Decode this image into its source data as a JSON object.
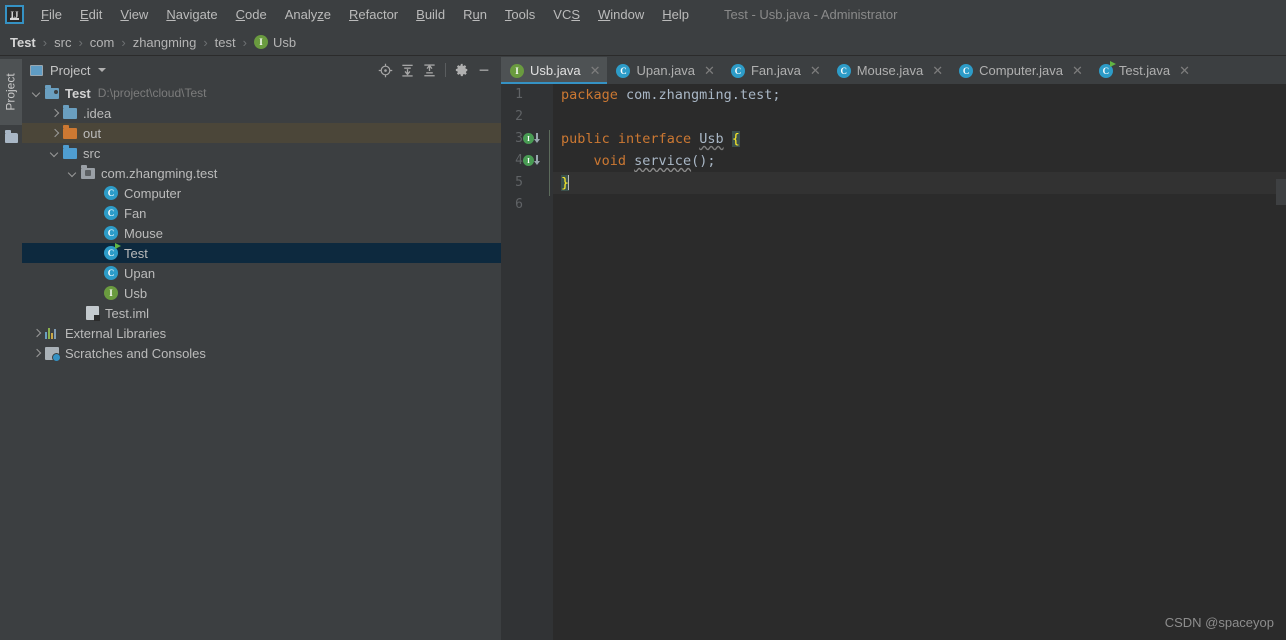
{
  "window": {
    "title": "Test - Usb.java - Administrator",
    "logo_text": "IJ"
  },
  "menubar": {
    "items": [
      {
        "label": "File",
        "mnemonic": "F"
      },
      {
        "label": "Edit",
        "mnemonic": "E"
      },
      {
        "label": "View",
        "mnemonic": "V"
      },
      {
        "label": "Navigate",
        "mnemonic": "N"
      },
      {
        "label": "Code",
        "mnemonic": "C"
      },
      {
        "label": "Analyze",
        "mnemonic": "z"
      },
      {
        "label": "Refactor",
        "mnemonic": "R"
      },
      {
        "label": "Build",
        "mnemonic": "B"
      },
      {
        "label": "Run",
        "mnemonic": "u"
      },
      {
        "label": "Tools",
        "mnemonic": "T"
      },
      {
        "label": "VCS",
        "mnemonic": "S"
      },
      {
        "label": "Window",
        "mnemonic": "W"
      },
      {
        "label": "Help",
        "mnemonic": "H"
      }
    ]
  },
  "navbar": {
    "crumbs": [
      {
        "label": "Test",
        "icon": "none"
      },
      {
        "label": "src",
        "icon": "none"
      },
      {
        "label": "com",
        "icon": "none"
      },
      {
        "label": "zhangming",
        "icon": "none"
      },
      {
        "label": "test",
        "icon": "none"
      },
      {
        "label": "Usb",
        "icon": "interface-icon"
      }
    ],
    "separator": "›"
  },
  "toolstrip": {
    "project_label": "Project"
  },
  "project_panel": {
    "title": "Project",
    "tools": [
      {
        "name": "locate-icon",
        "tooltip": "Select Opened File"
      },
      {
        "name": "expand-all-icon",
        "tooltip": "Expand All"
      },
      {
        "name": "collapse-all-icon",
        "tooltip": "Collapse All"
      },
      {
        "name": "gear-icon",
        "tooltip": "Settings"
      },
      {
        "name": "minimize-icon",
        "tooltip": "Hide"
      }
    ],
    "tree": [
      {
        "label": "Test",
        "path": "D:\\project\\cloud\\Test",
        "icon": "module-folder",
        "arrow": "down",
        "indent": 0,
        "state": "normal",
        "bold": true
      },
      {
        "label": ".idea",
        "path": "",
        "icon": "folder-blue",
        "arrow": "right",
        "indent": 1,
        "state": "normal",
        "bold": false
      },
      {
        "label": "out",
        "path": "",
        "icon": "folder-orange",
        "arrow": "right",
        "indent": 1,
        "state": "hovered",
        "bold": false
      },
      {
        "label": "src",
        "path": "",
        "icon": "folder-src",
        "arrow": "down",
        "indent": 1,
        "state": "normal",
        "bold": false
      },
      {
        "label": "com.zhangming.test",
        "path": "",
        "icon": "package-icon",
        "arrow": "down",
        "indent": 2,
        "state": "normal",
        "bold": false
      },
      {
        "label": "Computer",
        "path": "",
        "icon": "class-icon",
        "arrow": "none",
        "indent": 3,
        "state": "normal",
        "bold": false
      },
      {
        "label": "Fan",
        "path": "",
        "icon": "class-icon",
        "arrow": "none",
        "indent": 3,
        "state": "normal",
        "bold": false
      },
      {
        "label": "Mouse",
        "path": "",
        "icon": "class-icon",
        "arrow": "none",
        "indent": 3,
        "state": "normal",
        "bold": false
      },
      {
        "label": "Test",
        "path": "",
        "icon": "runnable-class-icon",
        "arrow": "none",
        "indent": 3,
        "state": "selected",
        "bold": false
      },
      {
        "label": "Upan",
        "path": "",
        "icon": "class-icon",
        "arrow": "none",
        "indent": 3,
        "state": "normal",
        "bold": false
      },
      {
        "label": "Usb",
        "path": "",
        "icon": "interface-icon",
        "arrow": "none",
        "indent": 3,
        "state": "normal",
        "bold": false
      },
      {
        "label": "Test.iml",
        "path": "",
        "icon": "iml-file-icon",
        "arrow": "none",
        "indent": 2,
        "state": "normal",
        "bold": false
      },
      {
        "label": "External Libraries",
        "path": "",
        "icon": "libraries-icon",
        "arrow": "right",
        "indent": 0,
        "state": "normal",
        "bold": false
      },
      {
        "label": "Scratches and Consoles",
        "path": "",
        "icon": "scratches-icon",
        "arrow": "right",
        "indent": 0,
        "state": "normal",
        "bold": false
      }
    ]
  },
  "editor": {
    "tabs": [
      {
        "label": "Usb.java",
        "icon": "interface-icon",
        "active": true,
        "close": "✕"
      },
      {
        "label": "Upan.java",
        "icon": "class-icon",
        "active": false,
        "close": "✕"
      },
      {
        "label": "Fan.java",
        "icon": "class-icon",
        "active": false,
        "close": "✕"
      },
      {
        "label": "Mouse.java",
        "icon": "class-icon",
        "active": false,
        "close": "✕"
      },
      {
        "label": "Computer.java",
        "icon": "class-icon",
        "active": false,
        "close": "✕"
      },
      {
        "label": "Test.java",
        "icon": "runnable-class-icon",
        "active": false,
        "close": "✕"
      }
    ],
    "line_numbers": [
      "1",
      "2",
      "3",
      "4",
      "5",
      "6"
    ],
    "current_line": 5,
    "gutter_markers": [
      {
        "line": 3,
        "icon": "implemented-by-icon",
        "letter": "I"
      },
      {
        "line": 4,
        "icon": "implemented-by-icon",
        "letter": "I"
      }
    ],
    "code": {
      "line1_kw": "package",
      "line1_rest": " com.zhangming.test;",
      "line3_kw1": "public",
      "line3_kw2": "interface",
      "line3_type": "Usb",
      "line3_brace": "{",
      "line4_kw": "void",
      "line4_method": "service",
      "line4_rest": "();",
      "line5_brace": "}"
    }
  },
  "watermark": {
    "text": "CSDN @spaceyop"
  }
}
